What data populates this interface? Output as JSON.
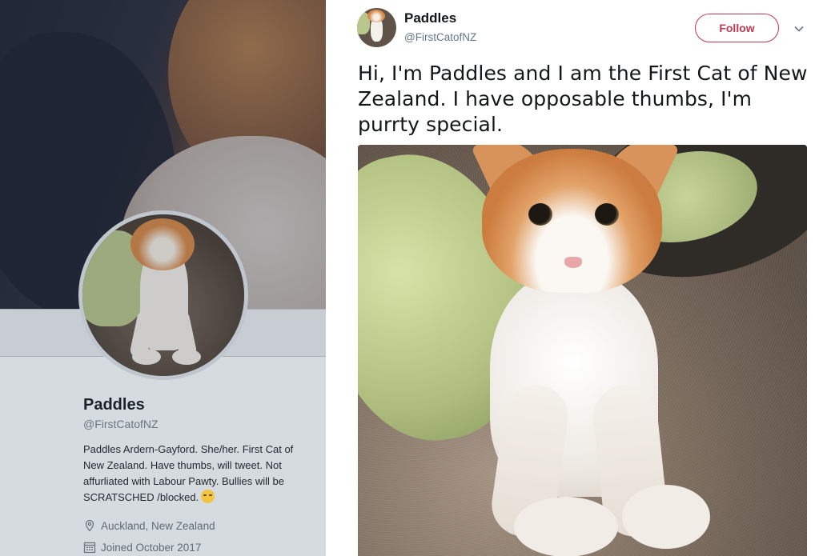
{
  "profile": {
    "name": "Paddles",
    "handle": "@FirstCatofNZ",
    "bio": "Paddles Ardern-Gayford. She/her. First Cat of New Zealand. Have thumbs, will tweet. Not affurliated with Labour Pawty. Bullies will be SCRATSCHED /blocked.",
    "bio_emoji": "kissing-face-emoji",
    "location": "Auckland, New Zealand",
    "location_icon": "location-pin-icon",
    "joined": "Joined October 2017",
    "joined_icon": "calendar-icon"
  },
  "tweet": {
    "author_name": "Paddles",
    "author_handle": "@FirstCatofNZ",
    "follow_label": "Follow",
    "text": "Hi, I'm Paddles and I am the First Cat of New Zealand. I have opposable thumbs, I'm purrty special.",
    "more_icon": "chevron-down-icon",
    "media": "photo-orange-white-cat-on-carpet"
  },
  "colors": {
    "follow_accent": "#c4384f",
    "name_text": "#14171a",
    "handle_text": "#657786",
    "panel_background": "#d6dbe0"
  }
}
